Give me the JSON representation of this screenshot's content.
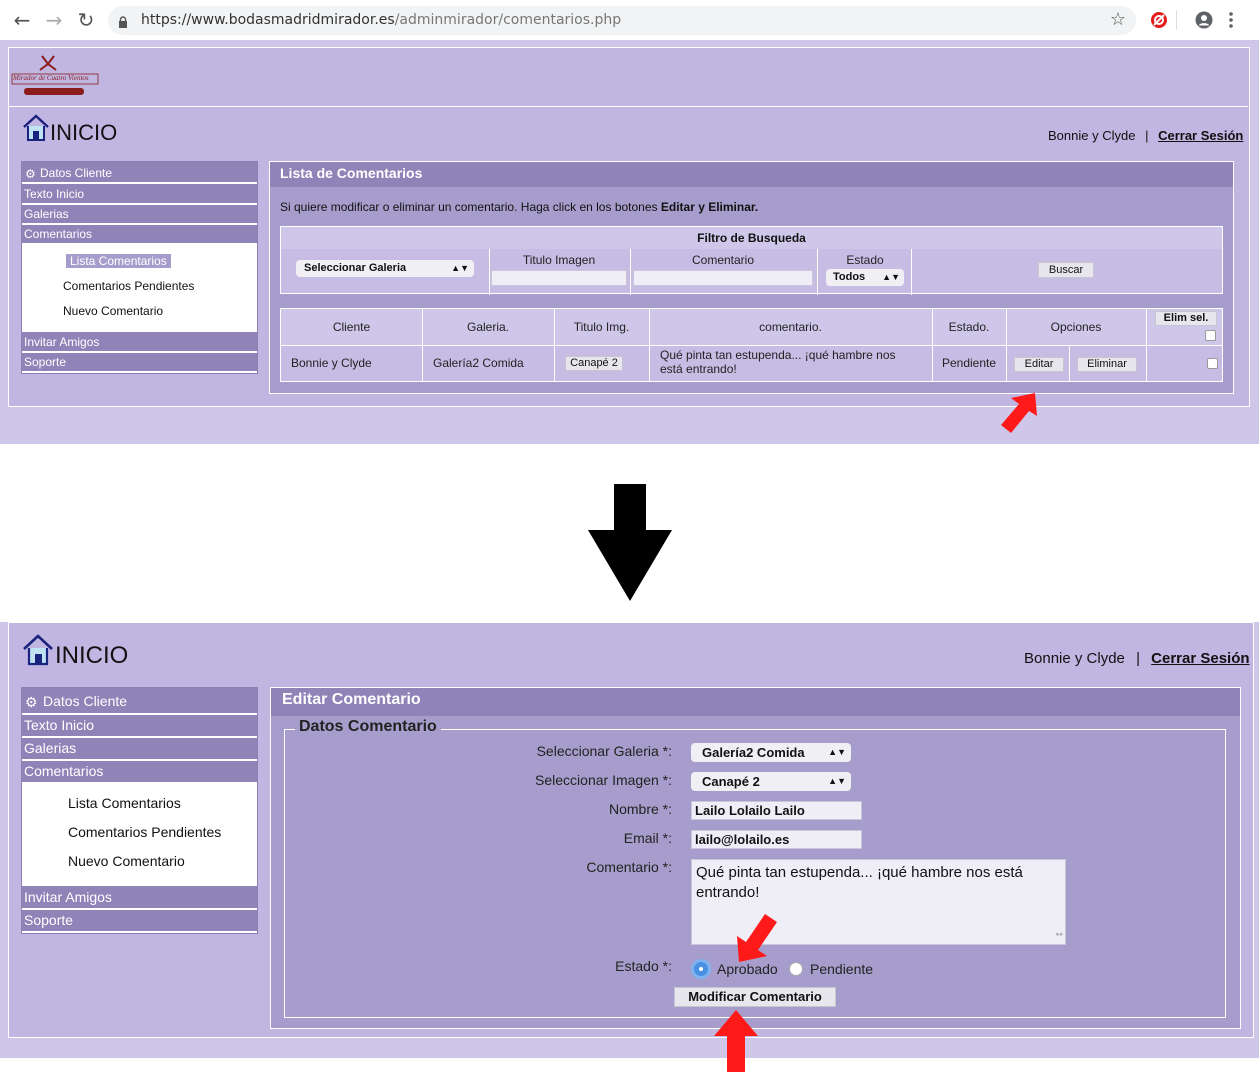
{
  "browser": {
    "url_host": "https://www.bodasmadridmirador.es",
    "url_path": "/adminmirador/comentarios.php",
    "icons": [
      "back-arrow-icon",
      "forward-arrow-icon",
      "reload-icon",
      "lock-icon",
      "star-icon",
      "extension-icon",
      "account-icon",
      "menu-dots-icon"
    ]
  },
  "logo": {
    "text": "Mirador de Cuatro Vientos"
  },
  "header": {
    "title": "INICIO",
    "user": "Bonnie y Clyde",
    "separator": "|",
    "logout": "Cerrar Sesión"
  },
  "sidebar": {
    "items": [
      "Datos Cliente",
      "Texto Inicio",
      "Galerias",
      "Comentarios"
    ],
    "sub_items": [
      "Lista Comentarios",
      "Comentarios Pendientes",
      "Nuevo Comentario"
    ],
    "bottom_items": [
      "Invitar Amigos",
      "Soporte"
    ]
  },
  "list_view": {
    "title": "Lista de Comentarios",
    "instruction": "Si quiere modificar o eliminar un comentario. Haga click en los botones ",
    "instruction_bold": "Editar y Eliminar.",
    "filter": {
      "heading": "Filtro de Busqueda",
      "galeria_select": "Seleccionar Galeria",
      "titulo_label": "Titulo Imagen",
      "comentario_label": "Comentario",
      "estado_label": "Estado",
      "estado_select": "Todos",
      "search_button": "Buscar"
    },
    "table": {
      "headers": [
        "Cliente",
        "Galeria.",
        "Titulo Img.",
        "comentario.",
        "Estado.",
        "Opciones",
        "Elim sel."
      ],
      "row": {
        "cliente": "Bonnie y Clyde",
        "galeria": "Galería2 Comida",
        "titulo": "Canapé 2",
        "comentario_line1": "Qué pinta tan estupenda... ¡qué hambre nos",
        "comentario_line2": "está entrando!",
        "estado": "Pendiente",
        "edit_button": "Editar",
        "delete_button": "Eliminar"
      }
    }
  },
  "edit_view": {
    "title": "Editar Comentario",
    "fieldset_legend": "Datos Comentario",
    "fields": {
      "galeria_label": "Seleccionar Galeria *:",
      "galeria_value": "Galería2 Comida",
      "imagen_label": "Seleccionar Imagen *:",
      "imagen_value": "Canapé 2",
      "nombre_label": "Nombre *:",
      "nombre_value": "Lailo Lolailo Lailo",
      "email_label": "Email *:",
      "email_value": "lailo@lolailo.es",
      "comentario_label": "Comentario *:",
      "comentario_line1": "Qué pinta tan estupenda... ¡qué hambre nos está",
      "comentario_line2": "entrando!",
      "estado_label": "Estado *:",
      "estado_options": [
        "Aprobado",
        "Pendiente"
      ],
      "estado_selected": "Aprobado"
    },
    "submit_button": "Modificar Comentario"
  },
  "colors": {
    "panel": "#cfc7ea",
    "header_bar": "#8f83b8",
    "arrow_red": "#ff1a1a"
  }
}
